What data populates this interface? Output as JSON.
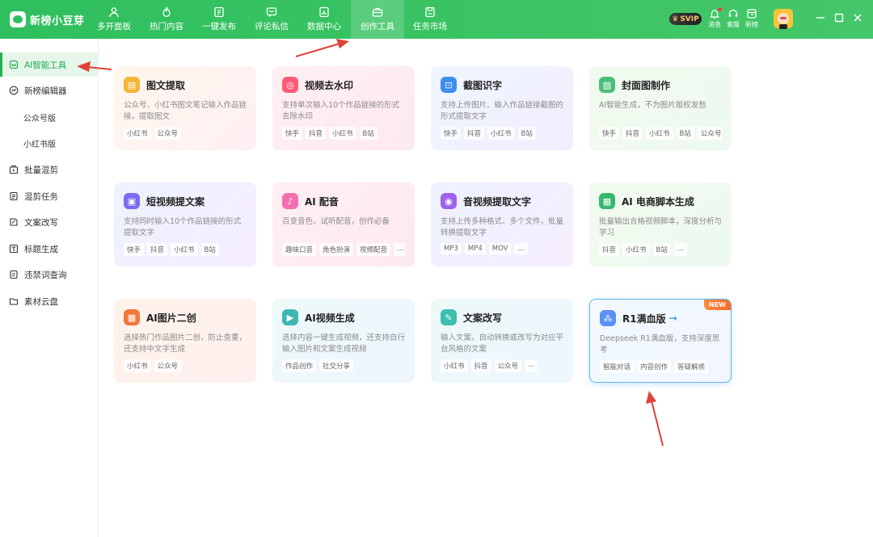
{
  "app": {
    "name": "新榜小豆芽"
  },
  "nav": {
    "tabs": [
      {
        "label": "多开面板",
        "icon": "user-icon"
      },
      {
        "label": "热门内容",
        "icon": "fire-icon"
      },
      {
        "label": "一键发布",
        "icon": "publish-icon"
      },
      {
        "label": "评论私信",
        "icon": "message-icon"
      },
      {
        "label": "数据中心",
        "icon": "chart-icon"
      },
      {
        "label": "创作工具",
        "icon": "toolbox-icon",
        "active": true
      },
      {
        "label": "任务市场",
        "icon": "save-icon"
      }
    ]
  },
  "top_right": {
    "svip": "SVIP",
    "message": "消息",
    "service": "客服",
    "newrank": "新榜"
  },
  "sidebar": {
    "items": [
      {
        "label": "AI智能工具",
        "icon": "ai-tool-icon",
        "active": true
      },
      {
        "label": "新榜编辑器",
        "icon": "editor-icon"
      },
      {
        "label": "公众号版",
        "sub": true
      },
      {
        "label": "小红书版",
        "sub": true
      },
      {
        "label": "批量混剪",
        "icon": "batch-edit-icon"
      },
      {
        "label": "混剪任务",
        "icon": "task-icon"
      },
      {
        "label": "文案改写",
        "icon": "rewrite-icon"
      },
      {
        "label": "标题生成",
        "icon": "title-icon"
      },
      {
        "label": "违禁词查询",
        "icon": "forbidden-word-icon"
      },
      {
        "label": "素材云盘",
        "icon": "folder-icon"
      }
    ]
  },
  "cards": [
    {
      "title": "图文提取",
      "desc": "公众号、小红书图文笔记输入作品链接，提取图文",
      "tags": [
        "小红书",
        "公众号"
      ],
      "theme": "warm",
      "icon": "image-text-icon",
      "icon_color": "#f5b53a"
    },
    {
      "title": "视频去水印",
      "desc": "支持单次输入10个作品链接的形式去除水印",
      "tags": [
        "快手",
        "抖音",
        "小红书",
        "B站"
      ],
      "theme": "pink",
      "icon": "watermark-remove-icon",
      "icon_color": "#ff5a7a"
    },
    {
      "title": "截图识字",
      "desc": "支持上传图片、输入作品链接截图的形式提取文字",
      "tags": [
        "快手",
        "抖音",
        "小红书",
        "B站"
      ],
      "theme": "blue",
      "icon": "screenshot-ocr-icon",
      "icon_color": "#3d8ff0"
    },
    {
      "title": "封面图制作",
      "desc": "AI智能生成，不为图片版权发愁",
      "tags": [
        "快手",
        "抖音",
        "小红书",
        "B站",
        "公众号"
      ],
      "theme": "green",
      "icon": "cover-image-icon",
      "icon_color": "#4cc07a"
    },
    {
      "title": "短视频提文案",
      "desc": "支持同时输入10个作品链接的形式提取文字",
      "tags": [
        "快手",
        "抖音",
        "小红书",
        "B站"
      ],
      "theme": "violet",
      "icon": "video-script-icon",
      "icon_color": "#7b6cf2"
    },
    {
      "title": "AI 配音",
      "desc": "百变音色，试听配音，创作必备",
      "tags": [
        "趣味口音",
        "角色扮演",
        "视频配音",
        "..."
      ],
      "theme": "pink",
      "icon": "voice-icon",
      "icon_color": "#f56fb0"
    },
    {
      "title": "音视频提取文字",
      "desc": "支持上传多种格式、多个文件，批量转换提取文字",
      "tags": [
        "MP3",
        "MP4",
        "MOV",
        "..."
      ],
      "theme": "violet",
      "icon": "audio-video-text-icon",
      "icon_color": "#a062ec"
    },
    {
      "title": "AI 电商脚本生成",
      "desc": "批量输出合格视频脚本，深度分析与学习",
      "tags": [
        "抖音",
        "小红书",
        "B站",
        "..."
      ],
      "theme": "green",
      "icon": "ecommerce-script-icon",
      "icon_color": "#35b96c"
    },
    {
      "title": "AI图片二创",
      "desc": "选择热门作品图片二创，防止查重，还支持中文字生成",
      "tags": [
        "小红书",
        "公众号"
      ],
      "theme": "orange",
      "icon": "image-remix-icon",
      "icon_color": "#f5763a"
    },
    {
      "title": "AI视频生成",
      "desc": "选择内容一键生成视频，还支持自行输入图片和文案生成视频",
      "tags": [
        "作品创作",
        "社交分享"
      ],
      "theme": "teal",
      "icon": "video-generate-icon",
      "icon_color": "#3fb6b2"
    },
    {
      "title": "文案改写",
      "desc": "输入文案，自动转换或改写为对应平台风格的文案",
      "tags": [
        "小红书",
        "抖音",
        "公众号",
        "..."
      ],
      "theme": "teal",
      "icon": "copy-rewrite-icon",
      "icon_color": "#3cbfae"
    },
    {
      "title": "R1满血版",
      "desc": "Deepseek R1满血版，支持深度思考",
      "tags": [
        "智能对话",
        "内容创作",
        "答疑解惑"
      ],
      "theme": "featured",
      "icon": "deepseek-icon",
      "icon_color": "#5b8ff5",
      "badge": "NEW",
      "arrow": "→"
    }
  ],
  "colors": {
    "brand_green": "#2fbf5e",
    "active_green": "#22b24f",
    "annotation_red": "#e0413a"
  }
}
